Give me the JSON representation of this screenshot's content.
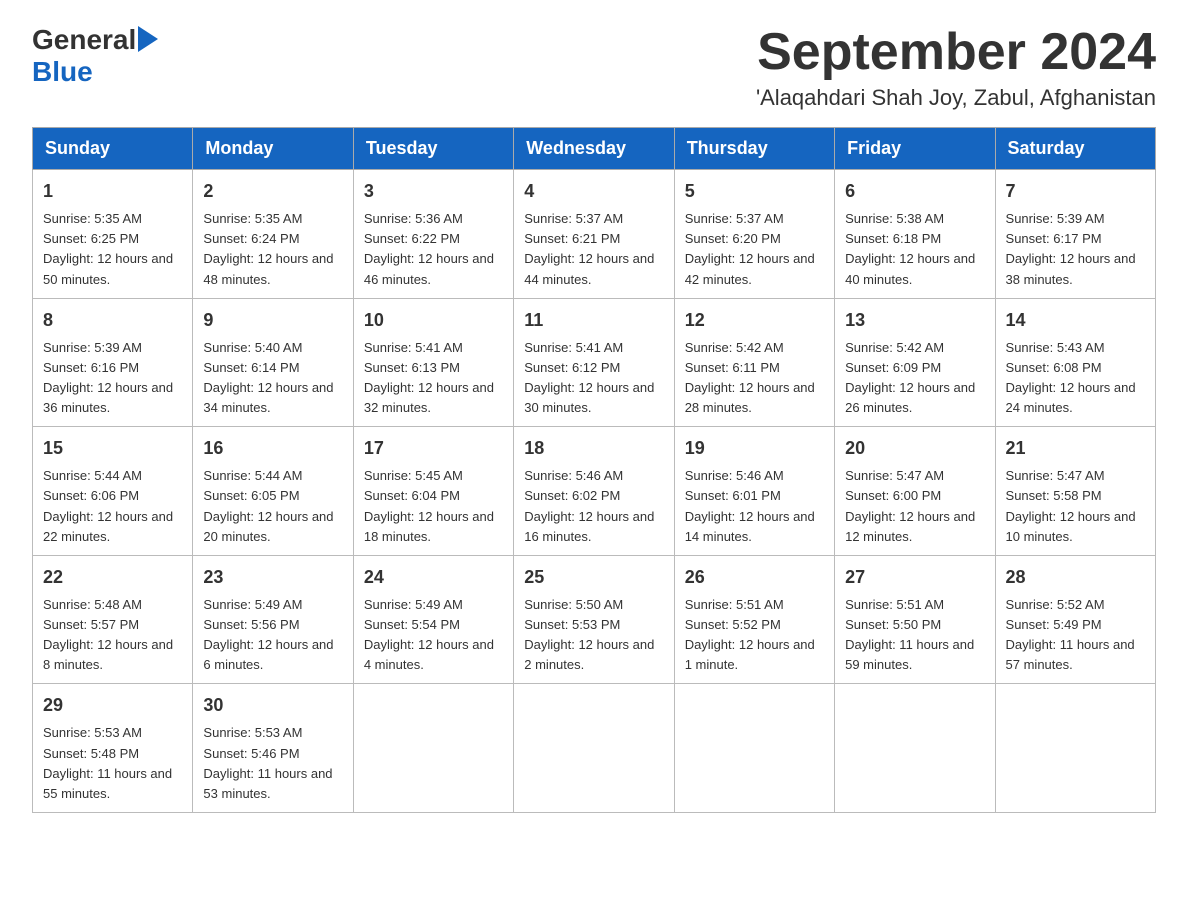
{
  "header": {
    "logo_general": "General",
    "logo_blue": "Blue",
    "month": "September 2024",
    "location": "'Alaqahdari Shah Joy, Zabul, Afghanistan"
  },
  "weekdays": [
    "Sunday",
    "Monday",
    "Tuesday",
    "Wednesday",
    "Thursday",
    "Friday",
    "Saturday"
  ],
  "weeks": [
    [
      {
        "day": "1",
        "sunrise": "5:35 AM",
        "sunset": "6:25 PM",
        "daylight": "12 hours and 50 minutes."
      },
      {
        "day": "2",
        "sunrise": "5:35 AM",
        "sunset": "6:24 PM",
        "daylight": "12 hours and 48 minutes."
      },
      {
        "day": "3",
        "sunrise": "5:36 AM",
        "sunset": "6:22 PM",
        "daylight": "12 hours and 46 minutes."
      },
      {
        "day": "4",
        "sunrise": "5:37 AM",
        "sunset": "6:21 PM",
        "daylight": "12 hours and 44 minutes."
      },
      {
        "day": "5",
        "sunrise": "5:37 AM",
        "sunset": "6:20 PM",
        "daylight": "12 hours and 42 minutes."
      },
      {
        "day": "6",
        "sunrise": "5:38 AM",
        "sunset": "6:18 PM",
        "daylight": "12 hours and 40 minutes."
      },
      {
        "day": "7",
        "sunrise": "5:39 AM",
        "sunset": "6:17 PM",
        "daylight": "12 hours and 38 minutes."
      }
    ],
    [
      {
        "day": "8",
        "sunrise": "5:39 AM",
        "sunset": "6:16 PM",
        "daylight": "12 hours and 36 minutes."
      },
      {
        "day": "9",
        "sunrise": "5:40 AM",
        "sunset": "6:14 PM",
        "daylight": "12 hours and 34 minutes."
      },
      {
        "day": "10",
        "sunrise": "5:41 AM",
        "sunset": "6:13 PM",
        "daylight": "12 hours and 32 minutes."
      },
      {
        "day": "11",
        "sunrise": "5:41 AM",
        "sunset": "6:12 PM",
        "daylight": "12 hours and 30 minutes."
      },
      {
        "day": "12",
        "sunrise": "5:42 AM",
        "sunset": "6:11 PM",
        "daylight": "12 hours and 28 minutes."
      },
      {
        "day": "13",
        "sunrise": "5:42 AM",
        "sunset": "6:09 PM",
        "daylight": "12 hours and 26 minutes."
      },
      {
        "day": "14",
        "sunrise": "5:43 AM",
        "sunset": "6:08 PM",
        "daylight": "12 hours and 24 minutes."
      }
    ],
    [
      {
        "day": "15",
        "sunrise": "5:44 AM",
        "sunset": "6:06 PM",
        "daylight": "12 hours and 22 minutes."
      },
      {
        "day": "16",
        "sunrise": "5:44 AM",
        "sunset": "6:05 PM",
        "daylight": "12 hours and 20 minutes."
      },
      {
        "day": "17",
        "sunrise": "5:45 AM",
        "sunset": "6:04 PM",
        "daylight": "12 hours and 18 minutes."
      },
      {
        "day": "18",
        "sunrise": "5:46 AM",
        "sunset": "6:02 PM",
        "daylight": "12 hours and 16 minutes."
      },
      {
        "day": "19",
        "sunrise": "5:46 AM",
        "sunset": "6:01 PM",
        "daylight": "12 hours and 14 minutes."
      },
      {
        "day": "20",
        "sunrise": "5:47 AM",
        "sunset": "6:00 PM",
        "daylight": "12 hours and 12 minutes."
      },
      {
        "day": "21",
        "sunrise": "5:47 AM",
        "sunset": "5:58 PM",
        "daylight": "12 hours and 10 minutes."
      }
    ],
    [
      {
        "day": "22",
        "sunrise": "5:48 AM",
        "sunset": "5:57 PM",
        "daylight": "12 hours and 8 minutes."
      },
      {
        "day": "23",
        "sunrise": "5:49 AM",
        "sunset": "5:56 PM",
        "daylight": "12 hours and 6 minutes."
      },
      {
        "day": "24",
        "sunrise": "5:49 AM",
        "sunset": "5:54 PM",
        "daylight": "12 hours and 4 minutes."
      },
      {
        "day": "25",
        "sunrise": "5:50 AM",
        "sunset": "5:53 PM",
        "daylight": "12 hours and 2 minutes."
      },
      {
        "day": "26",
        "sunrise": "5:51 AM",
        "sunset": "5:52 PM",
        "daylight": "12 hours and 1 minute."
      },
      {
        "day": "27",
        "sunrise": "5:51 AM",
        "sunset": "5:50 PM",
        "daylight": "11 hours and 59 minutes."
      },
      {
        "day": "28",
        "sunrise": "5:52 AM",
        "sunset": "5:49 PM",
        "daylight": "11 hours and 57 minutes."
      }
    ],
    [
      {
        "day": "29",
        "sunrise": "5:53 AM",
        "sunset": "5:48 PM",
        "daylight": "11 hours and 55 minutes."
      },
      {
        "day": "30",
        "sunrise": "5:53 AM",
        "sunset": "5:46 PM",
        "daylight": "11 hours and 53 minutes."
      },
      null,
      null,
      null,
      null,
      null
    ]
  ]
}
